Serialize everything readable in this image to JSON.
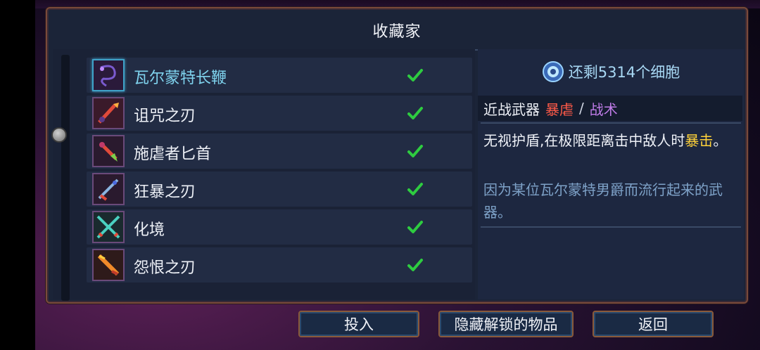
{
  "panel": {
    "title": "收藏家"
  },
  "items": [
    {
      "name": "瓦尔蒙特长鞭",
      "icon": "whip-icon",
      "selected": true
    },
    {
      "name": "诅咒之刃",
      "icon": "cursed-blade-icon",
      "selected": false
    },
    {
      "name": "施虐者匕首",
      "icon": "sadist-dagger-icon",
      "selected": false
    },
    {
      "name": "狂暴之刃",
      "icon": "frenzy-blade-icon",
      "selected": false
    },
    {
      "name": "化境",
      "icon": "crossed-swords-icon",
      "selected": false
    },
    {
      "name": "怨恨之刃",
      "icon": "spite-blade-icon",
      "selected": false
    }
  ],
  "detail": {
    "cells_remaining": "还剩5314个细胞",
    "category_main": "近战武器",
    "category_brutality": "暴虐",
    "category_separator": "/",
    "category_tactics": "战术",
    "description_prefix": "无视护盾,在极限距离击中敌人时",
    "description_crit": "暴击",
    "description_suffix": "。",
    "lore": "因为某位瓦尔蒙特男爵而流行起来的武器。"
  },
  "buttons": {
    "invest": "投入",
    "hide_unlocked": "隐藏解锁的物品",
    "back": "返回"
  },
  "colors": {
    "brutality": "#ff5a48",
    "tactics": "#c07ce8",
    "crit": "#ffd23a",
    "selected": "#3fa2c8",
    "check": "#2ecc40"
  }
}
